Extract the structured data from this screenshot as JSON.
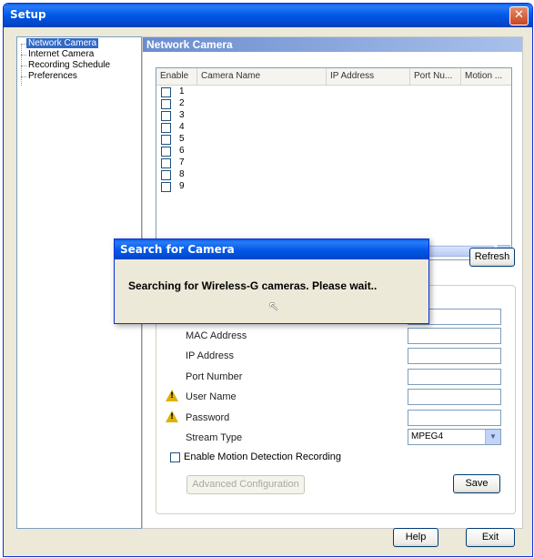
{
  "window": {
    "title": "Setup",
    "close_glyph": "✕"
  },
  "tree": {
    "items": [
      {
        "label": "Network Camera",
        "selected": true
      },
      {
        "label": "Internet Camera"
      },
      {
        "label": "Recording Schedule"
      },
      {
        "label": "Preferences"
      }
    ]
  },
  "panel": {
    "title": "Network Camera"
  },
  "camera_table": {
    "columns": [
      "Enable",
      "Camera Name",
      "IP Address",
      "Port Nu...",
      "Motion ..."
    ],
    "rows": [
      {
        "number": "1",
        "enabled": false
      },
      {
        "number": "2",
        "enabled": false
      },
      {
        "number": "3",
        "enabled": false
      },
      {
        "number": "4",
        "enabled": false
      },
      {
        "number": "5",
        "enabled": false
      },
      {
        "number": "6",
        "enabled": false
      },
      {
        "number": "7",
        "enabled": false
      },
      {
        "number": "8",
        "enabled": false
      },
      {
        "number": "9",
        "enabled": false
      }
    ],
    "scroll_left_glyph": "◀",
    "scroll_right_glyph": "▶"
  },
  "buttons": {
    "refresh": "Refresh",
    "advanced": "Advanced Configuration",
    "save": "Save",
    "help": "Help",
    "exit": "Exit"
  },
  "form": {
    "mac_address": "MAC Address",
    "ip_address": "IP Address",
    "port_number": "Port Number",
    "user_name": "User Name",
    "password": "Password",
    "stream_type": "Stream Type",
    "stream_type_value": "MPEG4",
    "motion_detection": "Enable Motion Detection Recording",
    "warning_glyph": "!"
  },
  "dialog": {
    "title": "Search for Camera",
    "message": "Searching for Wireless-G cameras. Please wait.."
  },
  "colors": {
    "titlebar": "#0058e6",
    "window_bg": "#ece9d8",
    "section_header": "#6b8dcf",
    "selection": "#316ac5",
    "close_button": "#c94522"
  },
  "icons": {
    "warning": "warning-icon",
    "close": "close-icon",
    "cursor": "mouse-cursor-icon"
  }
}
